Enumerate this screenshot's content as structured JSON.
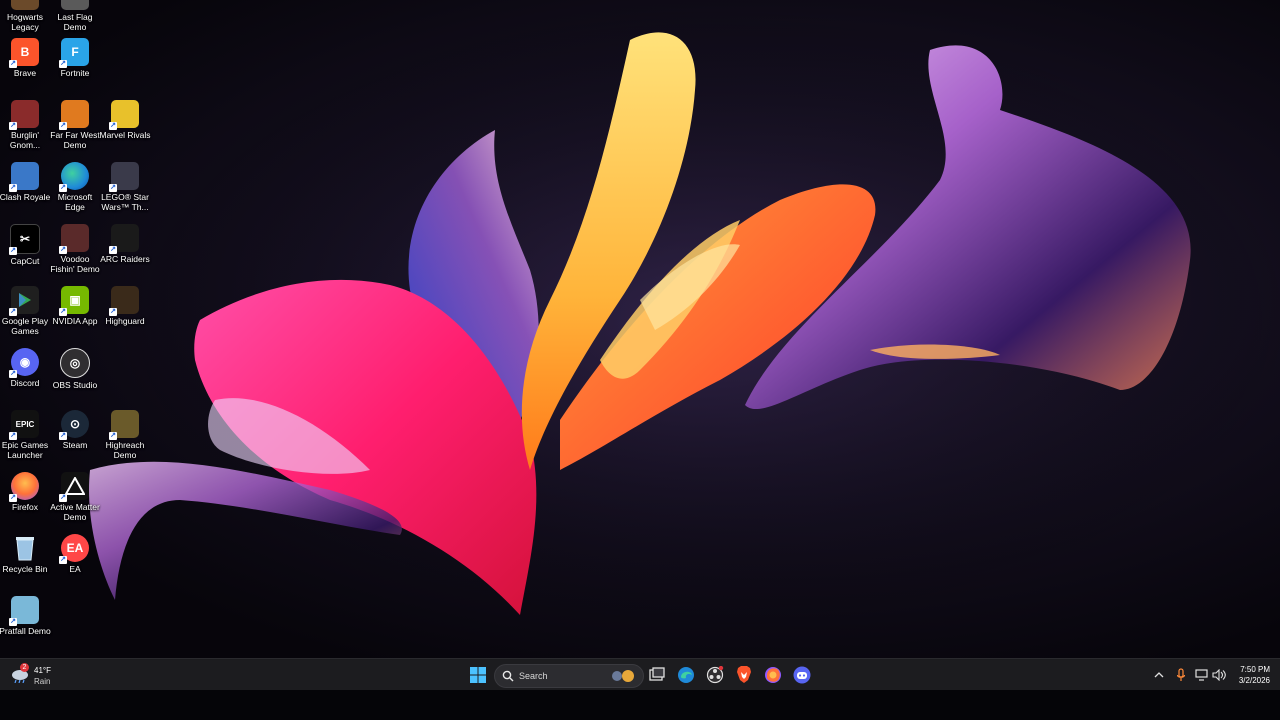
{
  "desktop_icons": [
    {
      "label": "Hogwarts Legacy",
      "icon": "hogwarts-legacy-icon",
      "color": "#6b4a2a"
    },
    {
      "label": "Last Flag Demo",
      "icon": "last-flag-icon",
      "color": "#5a5a5a"
    },
    {
      "label": "Brave",
      "icon": "brave-icon",
      "color": "#fb542b"
    },
    {
      "label": "Fortnite",
      "icon": "fortnite-icon",
      "color": "#2aa4e8"
    },
    {
      "label": "Burglin' Gnom...",
      "icon": "burglin-gnomes-icon",
      "color": "#8a2b2b"
    },
    {
      "label": "Far Far West Demo",
      "icon": "far-far-west-icon",
      "color": "#e07a1f"
    },
    {
      "label": "Marvel Rivals",
      "icon": "marvel-rivals-icon",
      "color": "#e8c12b"
    },
    {
      "label": "Clash Royale",
      "icon": "clash-royale-icon",
      "color": "#3a78c8"
    },
    {
      "label": "Microsoft Edge",
      "icon": "edge-icon",
      "color": "#1f8ad8"
    },
    {
      "label": "LEGO® Star Wars™ Th...",
      "icon": "lego-star-wars-icon",
      "color": "#3a3a4a"
    },
    {
      "label": "CapCut",
      "icon": "capcut-icon",
      "color": "#000000"
    },
    {
      "label": "Voodoo Fishin' Demo",
      "icon": "voodoo-fishin-icon",
      "color": "#5a2a2a"
    },
    {
      "label": "ARC Raiders",
      "icon": "arc-raiders-icon",
      "color": "#1a1a1a"
    },
    {
      "label": "Google Play Games",
      "icon": "google-play-games-icon",
      "color": "#1f1f1f"
    },
    {
      "label": "NVIDIA App",
      "icon": "nvidia-icon",
      "color": "#76b900"
    },
    {
      "label": "Highguard",
      "icon": "highguard-icon",
      "color": "#3a2a1a"
    },
    {
      "label": "Discord",
      "icon": "discord-icon",
      "color": "#5865f2"
    },
    {
      "label": "OBS Studio",
      "icon": "obs-studio-icon",
      "color": "#302e31"
    },
    {
      "label": "Epic Games Launcher",
      "icon": "epic-games-icon",
      "color": "#111111"
    },
    {
      "label": "Steam",
      "icon": "steam-icon",
      "color": "#1b2838"
    },
    {
      "label": "Highreach Demo",
      "icon": "highreach-icon",
      "color": "#6a5a2a"
    },
    {
      "label": "Firefox",
      "icon": "firefox-icon",
      "color": "#ff7139"
    },
    {
      "label": "Active Matter Demo",
      "icon": "active-matter-icon",
      "color": "#111111"
    },
    {
      "label": "Recycle Bin",
      "icon": "recycle-bin-icon",
      "color": "#7aa6c8"
    },
    {
      "label": "EA",
      "icon": "ea-icon",
      "color": "#ff4747"
    },
    {
      "label": "Pratfall Demo",
      "icon": "pratfall-icon",
      "color": "#7ab8d8"
    }
  ],
  "icon_glyphs": {
    "brave": "B",
    "fortnite": "F",
    "capcut": "✂",
    "discord": "◉",
    "epic": "EPIC",
    "steam": "⊙",
    "ea": "EA",
    "obs": "◎",
    "nvidia": "▣"
  },
  "weather": {
    "temp": "41°F",
    "condition": "Rain",
    "badge": "2"
  },
  "search": {
    "label": "Search"
  },
  "clock": {
    "time": "7:50 PM",
    "date": "3/2/2026"
  },
  "colors": {
    "taskbar": "#1c1c1f",
    "accent_windows": "#4cc2ff",
    "notification_red": "#e0353b"
  }
}
